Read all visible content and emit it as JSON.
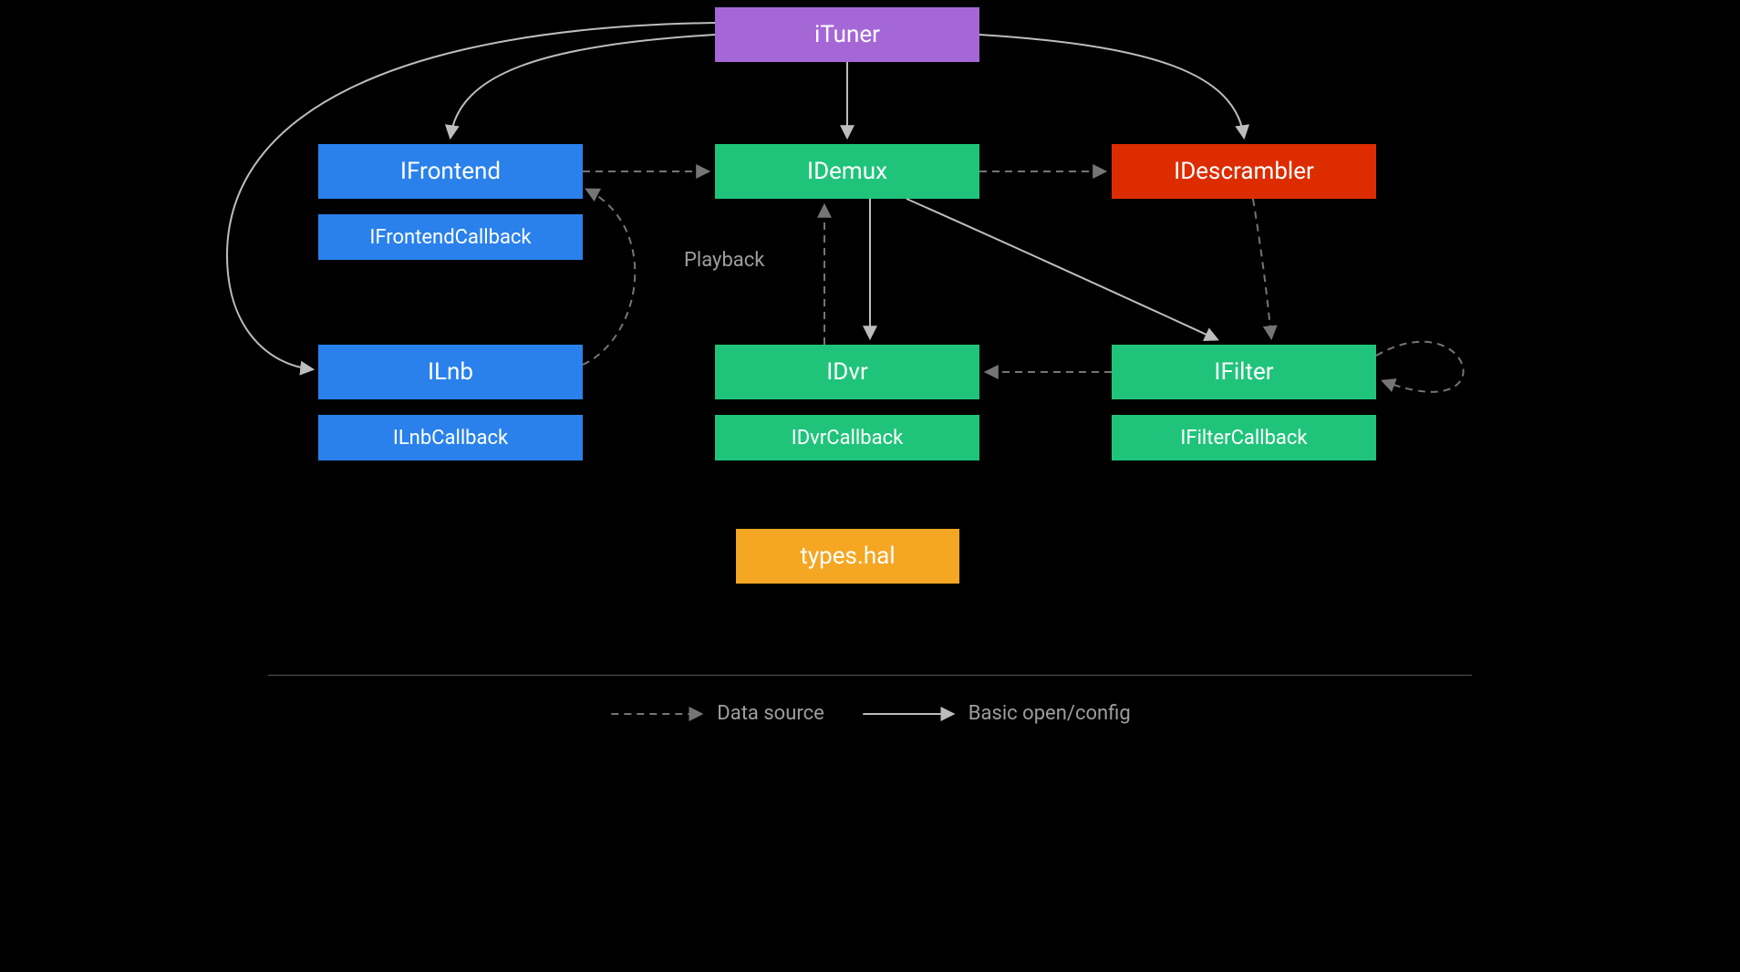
{
  "nodes": {
    "ituner": "iTuner",
    "ifrontend": "IFrontend",
    "ifrontendcb": "IFrontendCallback",
    "ilnb": "ILnb",
    "ilnbcb": "ILnbCallback",
    "idemux": "IDemux",
    "idvr": "IDvr",
    "idvrcb": "IDvrCallback",
    "ifilter": "IFilter",
    "ifiltercb": "IFilterCallback",
    "idescrambler": "IDescrambler",
    "types": "types.hal"
  },
  "labels": {
    "playback": "Playback"
  },
  "legend": {
    "data_source": "Data source",
    "basic": "Basic open/config"
  },
  "colors": {
    "purple": "#a667d6",
    "blue": "#2a81ec",
    "green": "#1fc47a",
    "red": "#dd2c00",
    "orange": "#f5a623",
    "arrow_solid": "#bdbdbd",
    "arrow_dashed": "#757575",
    "text_muted": "#9e9e9e"
  }
}
